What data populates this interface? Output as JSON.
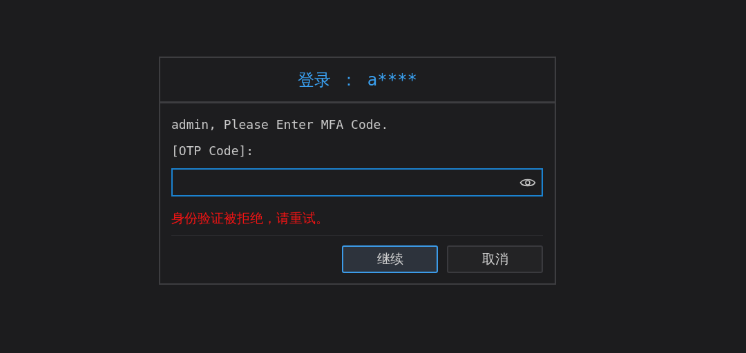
{
  "dialog": {
    "title": "登录 ： a****",
    "message": "admin, Please Enter MFA Code.",
    "field_label": "[OTP Code]:",
    "otp_field": {
      "focused": true
    },
    "error": "身份验证被拒绝，请重试。",
    "buttons": [
      {
        "label": "继续",
        "focused": true
      },
      {
        "label": "取消",
        "focused": false
      }
    ]
  }
}
